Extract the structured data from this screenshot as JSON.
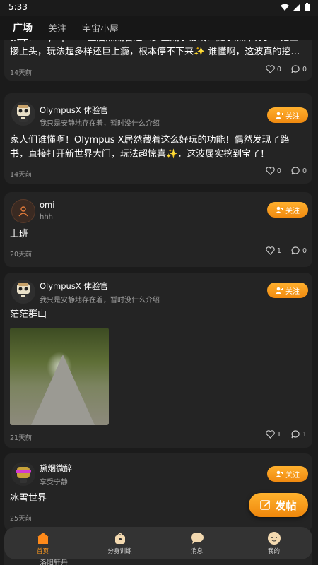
{
  "status_bar": {
    "time": "5:33"
  },
  "tabs": [
    {
      "label": "广场",
      "active": true
    },
    {
      "label": "关注",
      "active": false
    },
    {
      "label": "宇宙小屋",
      "active": false
    }
  ],
  "follow_label": "关注",
  "posts": [
    {
      "content": "救命！Olympus X里居然藏着这么多宝藏小游戏！随手点开玩了一把直接上头，玩法超多样还巨上瘾，根本停不下来✨ 谁懂啊，这波真的挖…",
      "time": "14天前",
      "likes": "0",
      "comments": "0"
    },
    {
      "username": "OlympusX 体验官",
      "bio": "我只是安静地存在着，暂时没什么介绍",
      "content": "家人们谁懂啊！Olympus X居然藏着这么好玩的功能！偶然发现了路书，直接打开新世界大门，玩法超惊喜✨，这波属实挖到宝了！",
      "time": "14天前",
      "likes": "0",
      "comments": "0"
    },
    {
      "username": "omi",
      "bio": "hhh",
      "content": "上班",
      "time": "20天前",
      "likes": "1",
      "comments": "0"
    },
    {
      "username": "OlympusX 体验官",
      "bio": "我只是安静地存在着，暂时没什么介绍",
      "content": "茫茫群山",
      "time": "21天前",
      "likes": "1",
      "comments": "1"
    },
    {
      "username": "黛烟微醉",
      "bio": "享受宁静",
      "content": "冰雪世界",
      "time": "25天前"
    },
    {
      "username": "洛阳轩丹"
    }
  ],
  "fab": {
    "label": "发帖"
  },
  "bottom_nav": [
    {
      "label": "首页",
      "active": true
    },
    {
      "label": "分身训练",
      "active": false
    },
    {
      "label": "消息",
      "active": false
    },
    {
      "label": "我的",
      "active": false
    }
  ],
  "colors": {
    "accent": "#f5961a",
    "background": "#1b1b1b",
    "card": "#242424"
  }
}
